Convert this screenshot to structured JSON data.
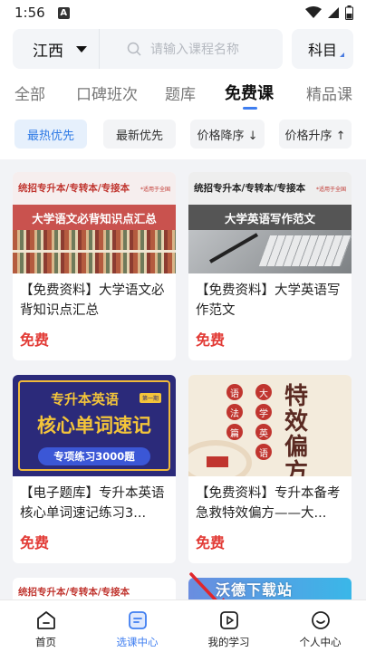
{
  "status": {
    "time": "1:56",
    "badge": "A"
  },
  "header": {
    "province": "江西",
    "search_placeholder": "请输入课程名称",
    "subject": "科目"
  },
  "tabs": [
    {
      "label": "全部",
      "active": false
    },
    {
      "label": "口碑班次",
      "active": false
    },
    {
      "label": "题库",
      "active": false
    },
    {
      "label": "免费课",
      "active": true
    },
    {
      "label": "精品课",
      "active": false
    }
  ],
  "filters": [
    {
      "label": "最热优先",
      "active": true
    },
    {
      "label": "最新优先",
      "active": false
    },
    {
      "label": "价格降序 ↓",
      "active": false
    },
    {
      "label": "价格升序 ↑",
      "active": false
    }
  ],
  "cards": [
    {
      "title": "【免费资料】大学语文必背知识点汇总",
      "price": "免费",
      "thumb_header": "统招专升本/专转本/专接本",
      "thumb_note": "*适用于全国",
      "thumb_banner": "大学语文必背知识点汇总"
    },
    {
      "title": "【免费资料】大学英语写作范文",
      "price": "免费",
      "thumb_header": "统招专升本/专转本/专接本",
      "thumb_note": "*适用于全国",
      "thumb_banner": "大学英语写作范文"
    },
    {
      "title": "【电子题库】专升本英语核心单词速记练习3...",
      "price": "免费",
      "thumb_line1": "专升本英语",
      "thumb_badge": "第一期",
      "thumb_line2": "核心单词速记",
      "thumb_pill": "专项练习3000题"
    },
    {
      "title": "【免费资料】专升本备考急救特效偏方——大...",
      "price": "免费",
      "thumb_big": "特效偏方",
      "thumb_c1": "语",
      "thumb_c2": "法",
      "thumb_c3": "篇",
      "thumb_c4": "大",
      "thumb_c5": "学",
      "thumb_c6": "英",
      "thumb_c7": "语"
    }
  ],
  "partial": {
    "p1_header": "统招专升本/专转本/专接本",
    "p2_watermark": "沃德下载站"
  },
  "nav": [
    {
      "label": "首页",
      "icon": "home-icon",
      "active": false
    },
    {
      "label": "选课中心",
      "icon": "course-center-icon",
      "active": true
    },
    {
      "label": "我的学习",
      "icon": "play-icon",
      "active": false
    },
    {
      "label": "个人中心",
      "icon": "smile-icon",
      "active": false
    }
  ],
  "colors": {
    "accent": "#3f7ef0",
    "price": "#e23b36",
    "annotation_arrow": "#e0262b"
  }
}
